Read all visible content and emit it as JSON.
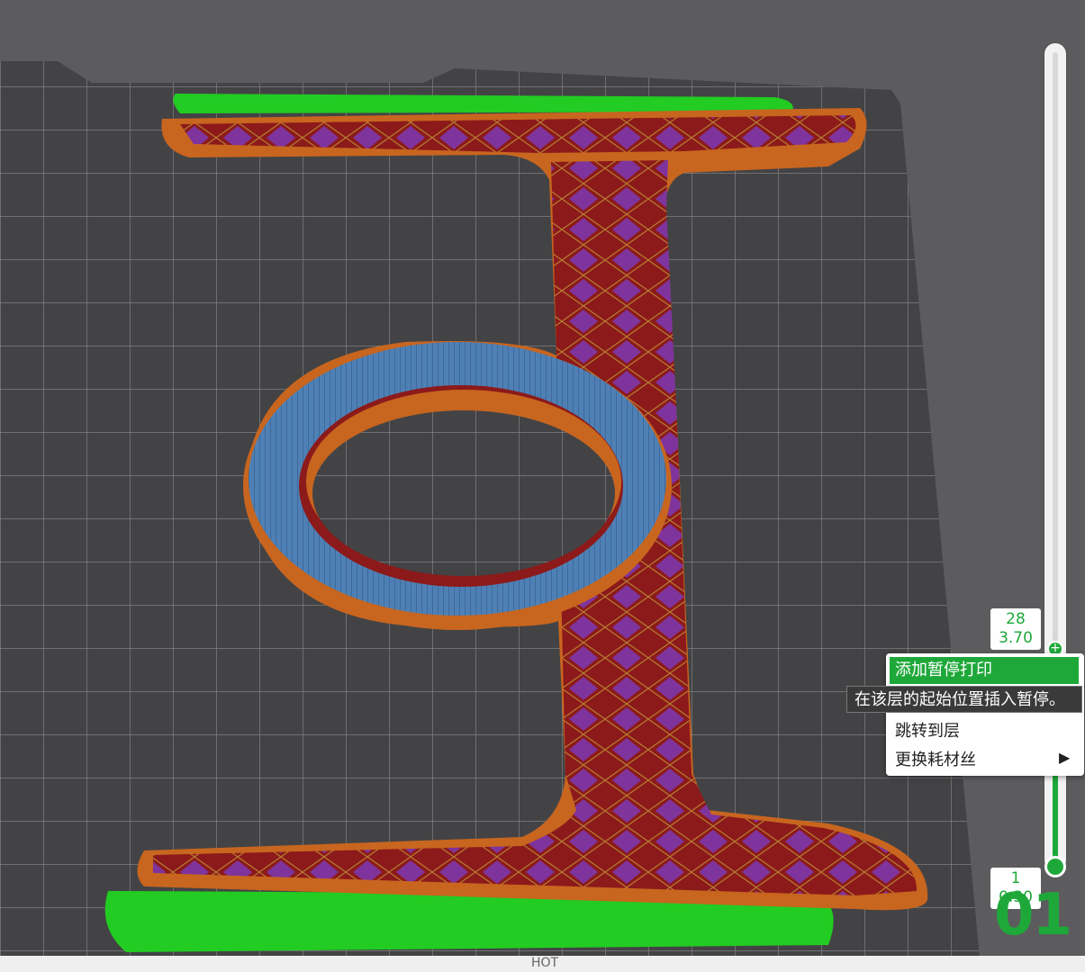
{
  "layer_slider": {
    "top_layer": "28",
    "top_height": "3.70",
    "bottom_layer": "1",
    "bottom_height": "0.30",
    "big_readout": "01"
  },
  "context_menu": {
    "items": [
      "添加暂停打印",
      "跳转到层",
      "更换耗材丝"
    ],
    "submenu_arrow": "▶"
  },
  "tooltip": "在该层的起始位置插入暂停。",
  "colors": {
    "bed": "#444446",
    "background": "#5c5c5e",
    "accent_green": "#1fa83a",
    "wall": "#c8651f",
    "infill": "#8c1a1a",
    "top_surface": "#4a7bb0",
    "skirt": "#22cc22"
  },
  "bottom_bar": {
    "text": "HOT"
  }
}
